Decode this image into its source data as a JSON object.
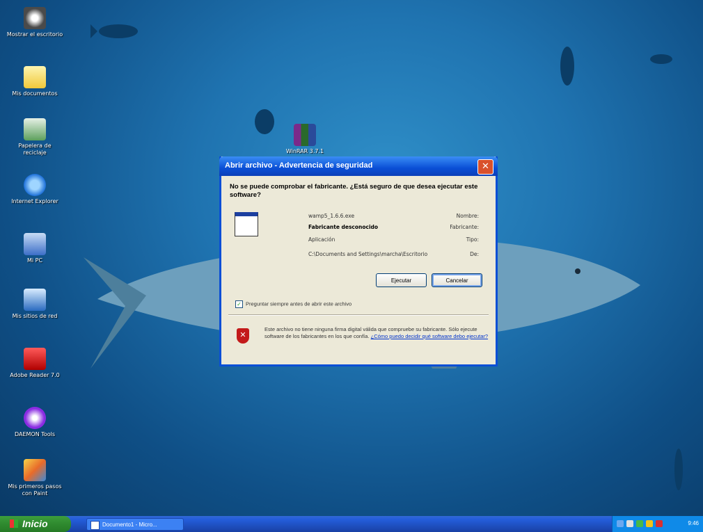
{
  "desktop": {
    "icons": [
      {
        "label": "Mostrar el escritorio"
      },
      {
        "label": "Mis documentos"
      },
      {
        "label": "Papelera de reciclaje"
      },
      {
        "label": "Internet Explorer"
      },
      {
        "label": "Mi PC"
      },
      {
        "label": "Mis sitios de red"
      },
      {
        "label": "Adobe Reader 7.0"
      },
      {
        "label": "DAEMON Tools"
      },
      {
        "label": "Mis primeros pasos con Paint"
      }
    ],
    "file_icon_label": "WinRAR 3.7.1"
  },
  "dialog": {
    "title": "Abrir archivo - Advertencia de seguridad",
    "question": "No se puede comprobar el fabricante. ¿Está seguro de que desea ejecutar este software?",
    "fields": [
      {
        "key": "Nombre:",
        "value": "wamp5_1.6.6.exe"
      },
      {
        "key": "Fabricante:",
        "value": "Fabricante desconocido"
      },
      {
        "key": "Tipo:",
        "value": "Aplicación"
      },
      {
        "key": "De:",
        "value": "C:\\Documents and Settings\\marcha\\Escritorio"
      }
    ],
    "run_button": "Ejecutar",
    "cancel_button": "Cancelar",
    "checkbox_label": "Preguntar siempre antes de abrir este archivo",
    "warning_text": "Este archivo no tiene ninguna firma digital válida que compruebe su fabricante. Sólo ejecute software de los fabricantes en los que confía.",
    "warning_link": "¿Cómo puedo decidir qué software debo ejecutar?"
  },
  "taskbar": {
    "start_label": "Inicio",
    "task_label": "Documento1 - Micro...",
    "clock": "9:46"
  }
}
